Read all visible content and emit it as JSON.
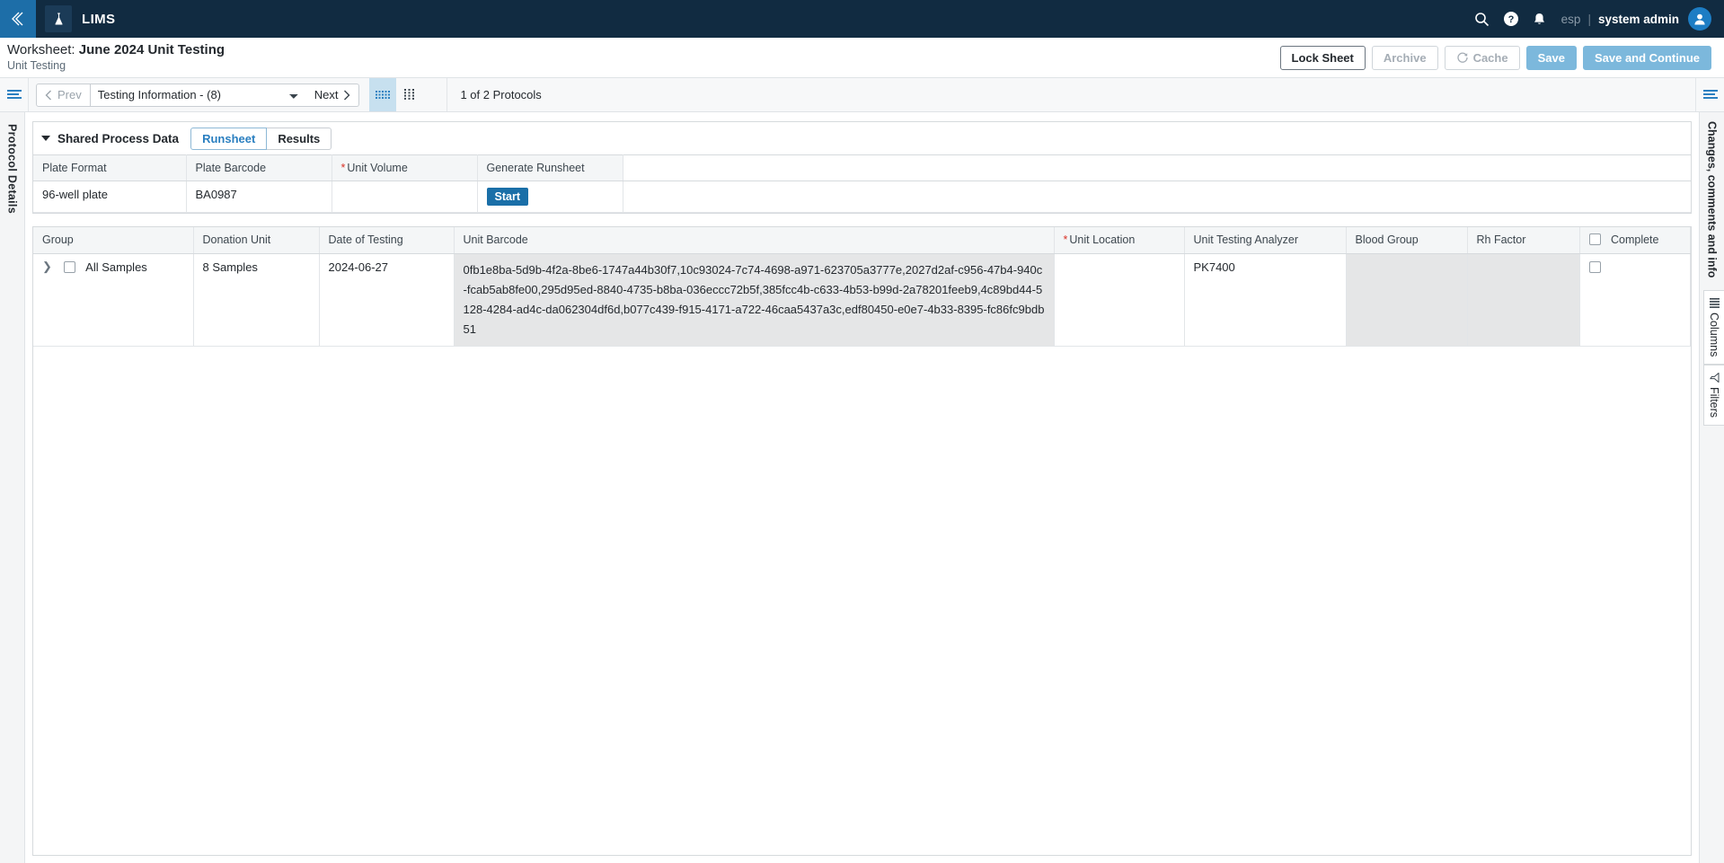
{
  "topbar": {
    "collapse_icon": "chevron-double-left-icon",
    "brand_icon": "flask-icon",
    "brand": "LIMS",
    "search_icon": "search-icon",
    "help_icon": "help-circle-icon",
    "notifications_icon": "bell-icon",
    "language": "esp",
    "separator": "|",
    "user": "system admin",
    "avatar_icon": "user-avatar-icon"
  },
  "title": {
    "prefix": "Worksheet: ",
    "name": "June 2024 Unit Testing",
    "subtitle": "Unit Testing"
  },
  "actions": {
    "lock_sheet": "Lock Sheet",
    "archive": "Archive",
    "cache": "Cache",
    "cache_icon": "refresh-icon",
    "save": "Save",
    "save_and_continue": "Save and Continue"
  },
  "toolbar": {
    "menu_icon": "list-menu-icon",
    "prev": "Prev",
    "next": "Next",
    "prev_icon": "chevron-left-icon",
    "next_icon": "chevron-right-icon",
    "protocol_selected": "Testing Information - (8)",
    "protocol_options": [
      "Testing Information - (8)"
    ],
    "view_grid_icon": "dense-grid-icon",
    "view_list_icon": "dot-grid-icon",
    "protocol_count": "1 of 2 Protocols",
    "right_menu_icon": "list-menu-icon"
  },
  "left_rail": {
    "menu_icon": "list-menu-icon",
    "label": "Protocol Details"
  },
  "right_rail": {
    "menu_icon": "list-menu-icon",
    "label": "Changes, comments and info",
    "columns_label": "Columns",
    "columns_icon": "columns-icon",
    "filters_label": "Filters",
    "filters_icon": "filter-icon"
  },
  "shared_process_data": {
    "title": "Shared Process Data",
    "caret_icon": "caret-down-icon",
    "tabs": [
      {
        "label": "Runsheet",
        "active": true
      },
      {
        "label": "Results",
        "active": false
      }
    ],
    "columns": [
      {
        "label": "Plate Format",
        "required": false
      },
      {
        "label": "Plate Barcode",
        "required": false
      },
      {
        "label": "Unit Volume",
        "required": true
      },
      {
        "label": "Generate Runsheet",
        "required": false
      }
    ],
    "row": {
      "plate_format": "96-well plate",
      "plate_barcode": "BA0987",
      "unit_volume": "",
      "generate_runsheet_button": "Start"
    }
  },
  "data_grid": {
    "columns": [
      {
        "label": "Group",
        "required": false
      },
      {
        "label": "Donation Unit",
        "required": false
      },
      {
        "label": "Date of Testing",
        "required": false
      },
      {
        "label": "Unit Barcode",
        "required": false
      },
      {
        "label": "Unit Location",
        "required": true
      },
      {
        "label": "Unit Testing Analyzer",
        "required": false
      },
      {
        "label": "Blood Group",
        "required": false
      },
      {
        "label": "Rh Factor",
        "required": false
      },
      {
        "label": "Complete",
        "required": false,
        "has_checkbox": true
      }
    ],
    "rows": [
      {
        "expander_icon": "chevron-right-icon",
        "select_checkbox": false,
        "group": "All Samples",
        "donation_unit": "8 Samples",
        "date_of_testing": "2024-06-27",
        "unit_barcode": "0fb1e8ba-5d9b-4f2a-8be6-1747a44b30f7,10c93024-7c74-4698-a971-623705a3777e,2027d2af-c956-47b4-940c-fcab5ab8fe00,295d95ed-8840-4735-b8ba-036eccc72b5f,385fcc4b-c633-4b53-b99d-2a78201feeb9,4c89bd44-5128-4284-ad4c-da062304df6d,b077c439-f915-4171-a722-46caa5437a3c,edf80450-e0e7-4b33-8395-fc86fc9bdb51",
        "unit_location": "",
        "unit_testing_analyzer": "PK7400",
        "blood_group": "",
        "rh_factor": "",
        "complete": false
      }
    ]
  },
  "colors": {
    "topbar_bg": "#112b41",
    "collapse_bg": "#1d6ea8",
    "accent_blue": "#2a7fc0",
    "primary_button": "#7cb8dc",
    "start_button": "#1a6fa8",
    "required_red": "#d93025",
    "active_toggle": "#c7e0ef",
    "readonly_cell": "#e5e6e7"
  }
}
